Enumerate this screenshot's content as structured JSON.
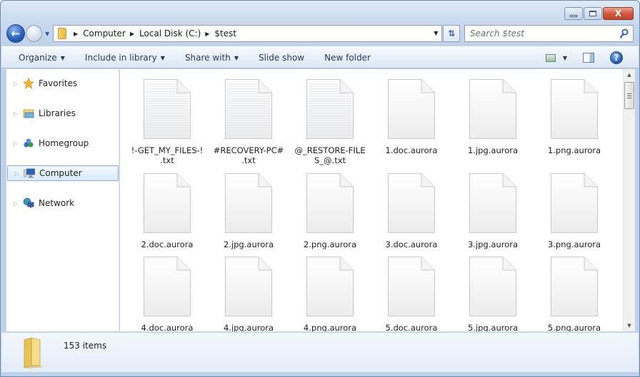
{
  "window": {
    "caption_buttons": {
      "minimize": "minimize",
      "maximize": "maximize",
      "close": "X"
    }
  },
  "nav": {
    "back_icon": "back-arrow-icon",
    "forward_icon": "forward-arrow-icon",
    "breadcrumb": [
      "Computer",
      "Local Disk (C:)",
      "$test"
    ],
    "search_placeholder": "Search $test"
  },
  "toolbar": {
    "organize": "Organize",
    "include_in_library": "Include in library",
    "share_with": "Share with",
    "slide_show": "Slide show",
    "new_folder": "New folder"
  },
  "sidebar": {
    "items": [
      {
        "label": "Favorites",
        "icon": "star-icon",
        "selected": false
      },
      {
        "label": "Libraries",
        "icon": "libraries-icon",
        "selected": false
      },
      {
        "label": "Homegroup",
        "icon": "homegroup-icon",
        "selected": false
      },
      {
        "label": "Computer",
        "icon": "computer-icon",
        "selected": true
      },
      {
        "label": "Network",
        "icon": "network-icon",
        "selected": false
      }
    ]
  },
  "files": [
    {
      "name": "!-GET_MY_FILES-!.txt",
      "line1": "!-GET_MY_FILES-!",
      "line2": ".txt",
      "type": "text"
    },
    {
      "name": "#RECOVERY-PC#.txt",
      "line1": "#RECOVERY-PC#",
      "line2": ".txt",
      "type": "text"
    },
    {
      "name": "@_RESTORE-FILES_@.txt",
      "line1": "@_RESTORE-FILE",
      "line2": "S_@.txt",
      "type": "text"
    },
    {
      "name": "1.doc.aurora",
      "line1": "1.doc.aurora",
      "line2": "",
      "type": "blank"
    },
    {
      "name": "1.jpg.aurora",
      "line1": "1.jpg.aurora",
      "line2": "",
      "type": "blank"
    },
    {
      "name": "1.png.aurora",
      "line1": "1.png.aurora",
      "line2": "",
      "type": "blank"
    },
    {
      "name": "2.doc.aurora",
      "line1": "2.doc.aurora",
      "line2": "",
      "type": "blank"
    },
    {
      "name": "2.jpg.aurora",
      "line1": "2.jpg.aurora",
      "line2": "",
      "type": "blank"
    },
    {
      "name": "2.png.aurora",
      "line1": "2.png.aurora",
      "line2": "",
      "type": "blank"
    },
    {
      "name": "3.doc.aurora",
      "line1": "3.doc.aurora",
      "line2": "",
      "type": "blank"
    },
    {
      "name": "3.jpg.aurora",
      "line1": "3.jpg.aurora",
      "line2": "",
      "type": "blank"
    },
    {
      "name": "3.png.aurora",
      "line1": "3.png.aurora",
      "line2": "",
      "type": "blank"
    },
    {
      "name": "4.doc.aurora",
      "line1": "4.doc.aurora",
      "line2": "",
      "type": "blank"
    },
    {
      "name": "4.jpg.aurora",
      "line1": "4.jpg.aurora",
      "line2": "",
      "type": "blank"
    },
    {
      "name": "4.png.aurora",
      "line1": "4.png.aurora",
      "line2": "",
      "type": "blank"
    },
    {
      "name": "5.doc.aurora",
      "line1": "5.doc.aurora",
      "line2": "",
      "type": "blank"
    },
    {
      "name": "5.jpg.aurora",
      "line1": "5.jpg.aurora",
      "line2": "",
      "type": "blank"
    },
    {
      "name": "5.png.aurora",
      "line1": "5.png.aurora",
      "line2": "",
      "type": "blank"
    }
  ],
  "details": {
    "item_count": "153 items"
  }
}
